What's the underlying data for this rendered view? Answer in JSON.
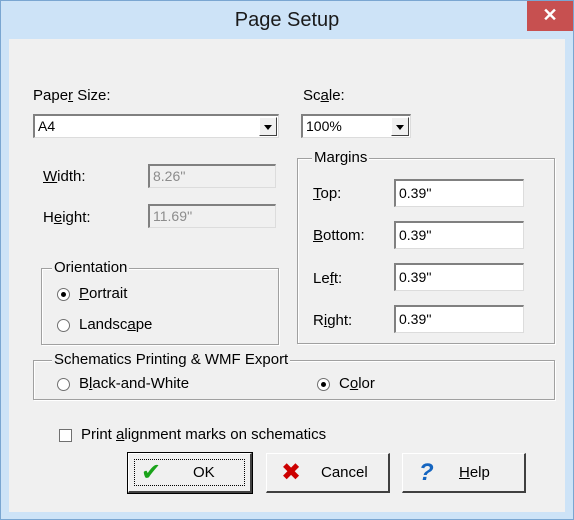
{
  "window": {
    "title": "Page Setup",
    "close_glyph": "✕"
  },
  "paper_size": {
    "label_pre": "Pape",
    "label_u": "r",
    "label_post": " Size:",
    "value": "A4"
  },
  "scale": {
    "label_pre": "Sc",
    "label_u": "a",
    "label_post": "le:",
    "value": "100%"
  },
  "width": {
    "label_pre": "",
    "label_u": "W",
    "label_post": "idth:",
    "value": "8.26''"
  },
  "height": {
    "label_pre": "H",
    "label_u": "e",
    "label_post": "ight:",
    "value": "11.69''"
  },
  "orientation": {
    "legend": "Orientation",
    "portrait": {
      "label_pre": "",
      "label_u": "P",
      "label_post": "ortrait",
      "checked": true
    },
    "landscape": {
      "label_pre": "Landsc",
      "label_u": "a",
      "label_post": "pe",
      "checked": false
    }
  },
  "margins": {
    "legend": "Margins",
    "top": {
      "label_pre": "",
      "label_u": "T",
      "label_post": "op:",
      "value": "0.39''"
    },
    "bottom": {
      "label_pre": "",
      "label_u": "B",
      "label_post": "ottom:",
      "value": "0.39''"
    },
    "left": {
      "label_pre": "Le",
      "label_u": "f",
      "label_post": "t:",
      "value": "0.39''"
    },
    "right": {
      "label_pre": "R",
      "label_u": "i",
      "label_post": "ght:",
      "value": "0.39''"
    }
  },
  "schematics": {
    "legend": "Schematics Printing & WMF Export",
    "bw": {
      "label_pre": "B",
      "label_u": "l",
      "label_post": "ack-and-White",
      "checked": false
    },
    "color": {
      "label_pre": "C",
      "label_u": "o",
      "label_post": "lor",
      "checked": true
    }
  },
  "alignment": {
    "label_pre": "Print ",
    "label_u": "a",
    "label_post": "lignment marks on schematics",
    "checked": false
  },
  "buttons": {
    "ok": {
      "label": "OK",
      "icon": "✔"
    },
    "cancel": {
      "label": "Cancel",
      "icon": "✖"
    },
    "help": {
      "label_pre": "",
      "label_u": "H",
      "label_post": "elp",
      "icon": "?"
    }
  },
  "colors": {
    "ok_icon": "#1aa31a",
    "cancel_icon": "#cc0000",
    "help_icon": "#1565c0",
    "close_bg": "#c75050"
  }
}
